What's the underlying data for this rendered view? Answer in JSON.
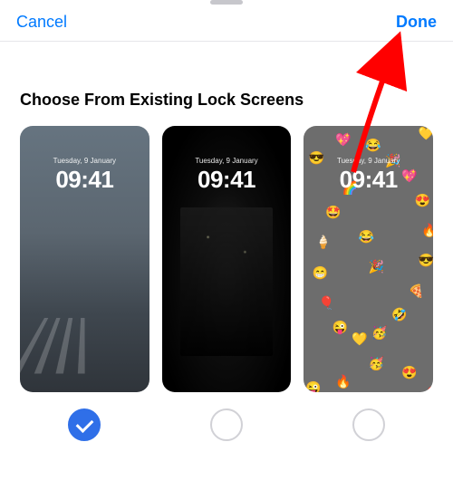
{
  "nav": {
    "cancel_label": "Cancel",
    "done_label": "Done"
  },
  "section": {
    "title": "Choose From Existing Lock Screens"
  },
  "lock_screens": [
    {
      "date": "Tuesday, 9 January",
      "time": "09:41",
      "theme": "city-fog",
      "selected": true
    },
    {
      "date": "Tuesday, 9 January",
      "time": "09:41",
      "theme": "night-street",
      "selected": false
    },
    {
      "date": "Tuesday, 9 January",
      "time": "09:41",
      "theme": "emoji-spiral",
      "selected": false
    }
  ],
  "colors": {
    "accent": "#007aff",
    "selected_radio": "#2f6fe8",
    "annotation_arrow": "#ff0000"
  },
  "annotation": {
    "arrow_target": "done-button"
  }
}
